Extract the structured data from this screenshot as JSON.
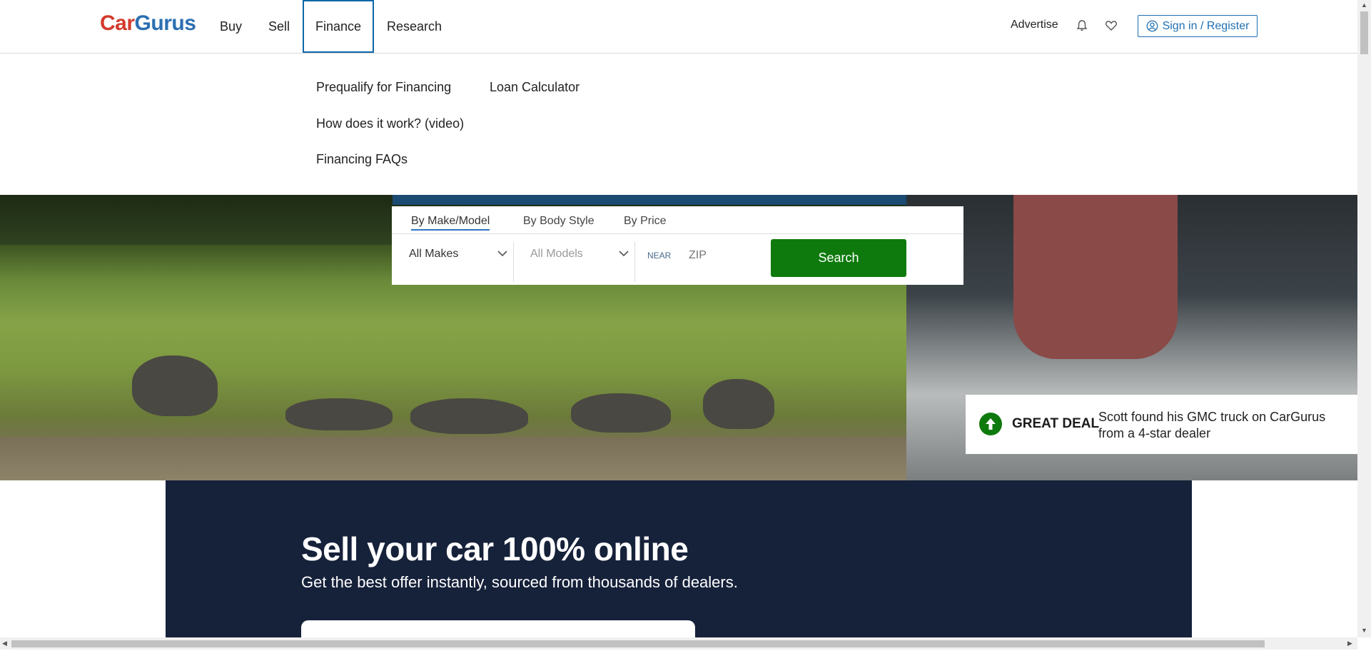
{
  "header": {
    "logo_car": "Car",
    "logo_gurus": "Gurus",
    "nav": [
      "Buy",
      "Sell",
      "Finance",
      "Research"
    ],
    "advertise": "Advertise",
    "signin": "Sign in / Register"
  },
  "finance_menu": {
    "items": [
      "Prequalify for Financing",
      "Loan Calculator",
      "How does it work? (video)",
      "Financing FAQs"
    ]
  },
  "search": {
    "tabs": [
      "By Make/Model",
      "By Body Style",
      "By Price"
    ],
    "make_select": "All Makes",
    "model_select": "All Models",
    "near_label": "NEAR",
    "zip_placeholder": "ZIP",
    "button": "Search"
  },
  "deal": {
    "badge": "GREAT DEAL",
    "text": "Scott found his GMC truck on CarGurus from a 4-star dealer"
  },
  "sell": {
    "title": "Sell your car 100% online",
    "subtitle": "Get the best offer instantly, sourced from thousands of dealers."
  },
  "colors": {
    "brand_blue": "#2c6fb1",
    "brand_red": "#d33a2c",
    "search_green": "#0e7a0d",
    "sell_navy": "#16213a"
  }
}
